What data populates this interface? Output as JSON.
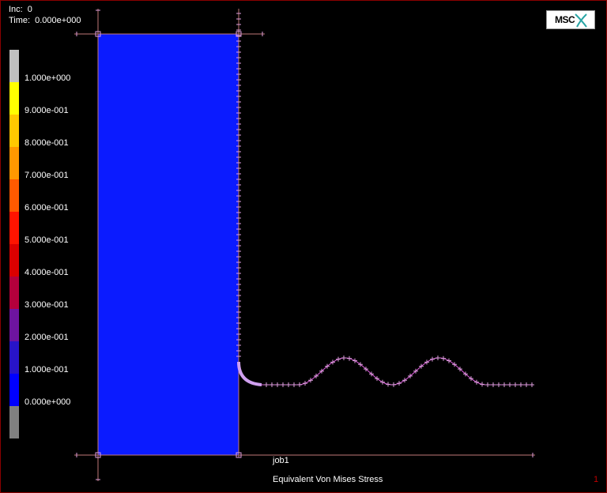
{
  "hud": {
    "inc_label": "Inc:",
    "inc_value": "0",
    "time_label": "Time:",
    "time_value": "0.000e+000"
  },
  "logo": {
    "text": "MSC"
  },
  "legend": {
    "bands": [
      {
        "color": "#c0c0c0",
        "label": "1.000e+000"
      },
      {
        "color": "#ffff00",
        "label": "9.000e-001"
      },
      {
        "color": "#ffc800",
        "label": "8.000e-001"
      },
      {
        "color": "#ff9800",
        "label": "7.000e-001"
      },
      {
        "color": "#ff5a00",
        "label": "6.000e-001"
      },
      {
        "color": "#ff1400",
        "label": "5.000e-001"
      },
      {
        "color": "#dc0000",
        "label": "4.000e-001"
      },
      {
        "color": "#b4003c",
        "label": "3.000e-001"
      },
      {
        "color": "#6e14a0",
        "label": "2.000e-001"
      },
      {
        "color": "#2814c8",
        "label": "1.000e-001"
      },
      {
        "color": "#0000ff",
        "label": "0.000e+000"
      },
      {
        "color": "#808080",
        "label": ""
      }
    ]
  },
  "model": {
    "fill_color": "#0b1bff"
  },
  "job_label": "job1",
  "result_title": "Equivalent Von Mises Stress",
  "page_number": "1"
}
